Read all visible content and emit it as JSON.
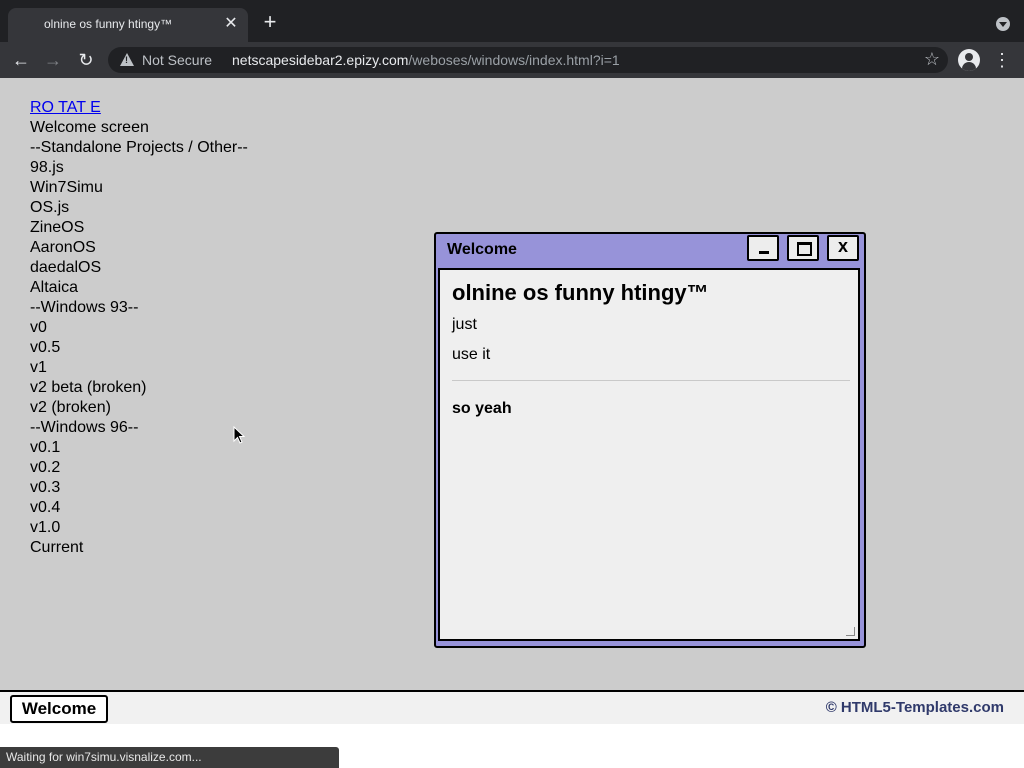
{
  "browser": {
    "tab_title": "olnine os funny htingy™",
    "tab_close": "✕",
    "new_tab": "+",
    "back": "←",
    "forward": "→",
    "reload": "↻",
    "security_label": "Not Secure",
    "url_host": "netscapesidebar2.epizy.com",
    "url_path": "/weboses/windows/index.html?i=1",
    "star": "☆",
    "menu": "⋮"
  },
  "sidebar": {
    "rotate_link": "RO TAT E",
    "items": [
      "Welcome screen",
      "--Standalone Projects / Other--",
      "98.js",
      "Win7Simu",
      "OS.js",
      "ZineOS",
      "AaronOS",
      "daedalOS",
      "Altaica",
      "--Windows 93--",
      "v0",
      "v0.5",
      "v1",
      "v2 beta (broken)",
      "v2 (broken)",
      "--Windows 96--",
      "v0.1",
      "v0.2",
      "v0.3",
      "v0.4",
      "v1.0",
      "Current"
    ]
  },
  "window": {
    "title": "Welcome",
    "heading": "olnine os funny htingy™",
    "line1": "just",
    "line2": "use it",
    "bold_line": "so yeah",
    "accent_color": "#9793d9"
  },
  "taskbar": {
    "button_label": "Welcome",
    "credit": "© HTML5-Templates.com"
  },
  "status": {
    "text": "Waiting for win7simu.visnalize.com..."
  }
}
